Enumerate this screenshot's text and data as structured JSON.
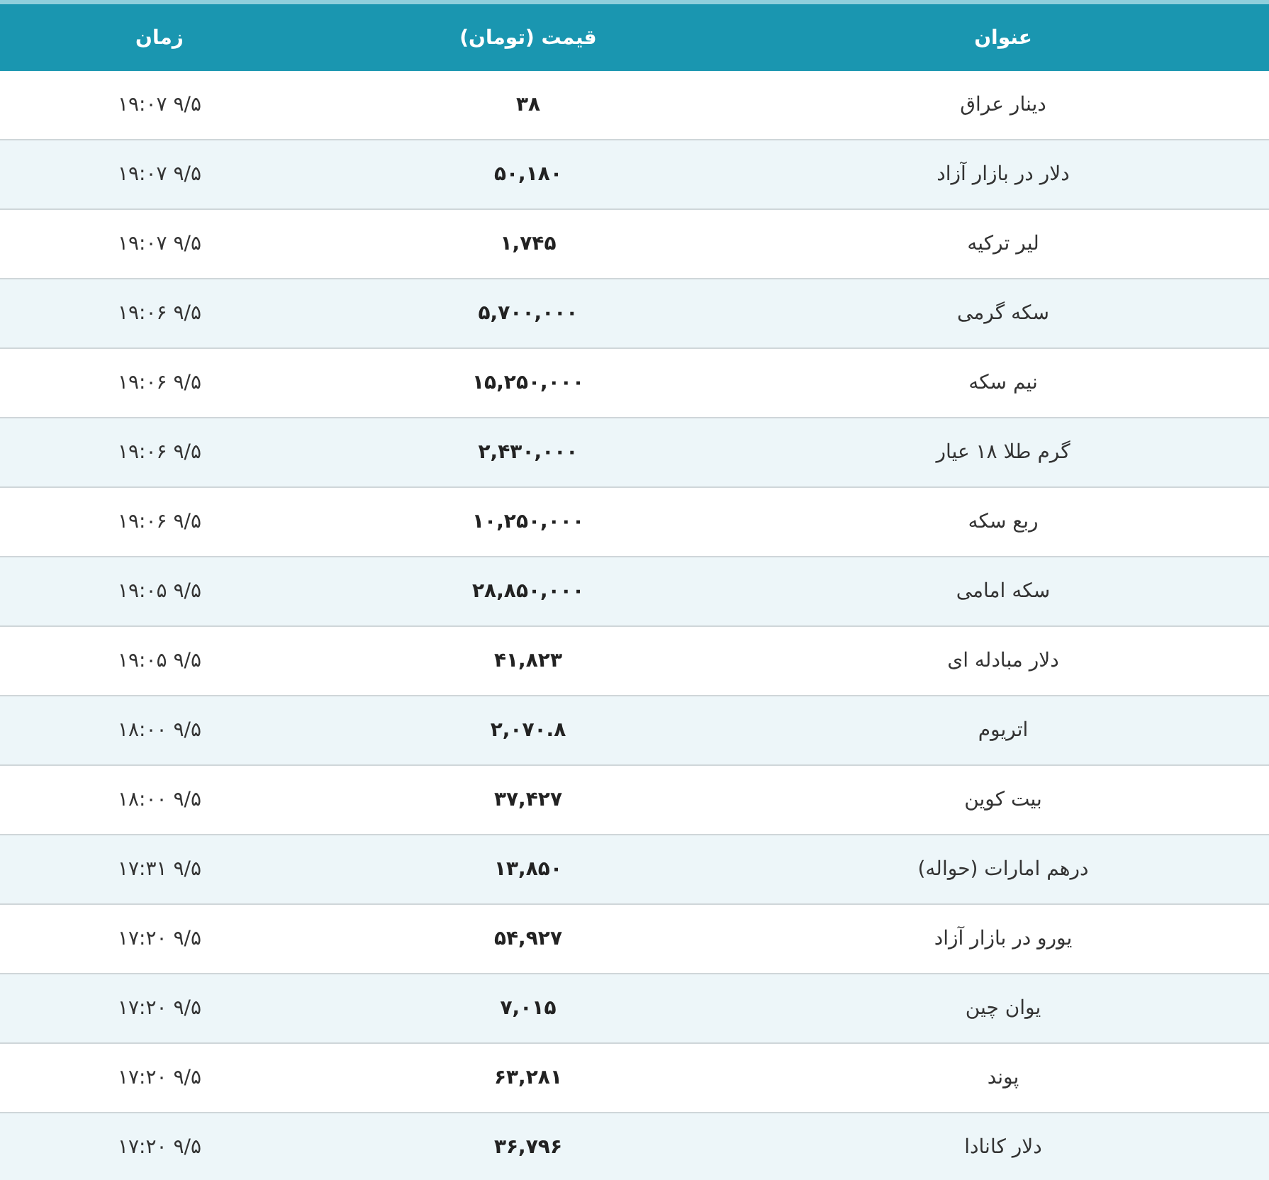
{
  "table": {
    "columns": [
      "عنوان",
      "قیمت (تومان)",
      "زمان"
    ],
    "rows": [
      {
        "title": "دینار عراق",
        "price": "۳۸",
        "time": "۹/۵ ۱۹:۰۷"
      },
      {
        "title": "دلار در بازار آزاد",
        "price": "۵۰,۱۸۰",
        "time": "۹/۵ ۱۹:۰۷"
      },
      {
        "title": "لیر ترکیه",
        "price": "۱,۷۴۵",
        "time": "۹/۵ ۱۹:۰۷"
      },
      {
        "title": "سکه گرمی",
        "price": "۵,۷۰۰,۰۰۰",
        "time": "۹/۵ ۱۹:۰۶"
      },
      {
        "title": "نیم سکه",
        "price": "۱۵,۲۵۰,۰۰۰",
        "time": "۹/۵ ۱۹:۰۶"
      },
      {
        "title": "گرم طلا ۱۸ عیار",
        "price": "۲,۴۳۰,۰۰۰",
        "time": "۹/۵ ۱۹:۰۶"
      },
      {
        "title": "ربع سکه",
        "price": "۱۰,۲۵۰,۰۰۰",
        "time": "۹/۵ ۱۹:۰۶"
      },
      {
        "title": "سکه امامی",
        "price": "۲۸,۸۵۰,۰۰۰",
        "time": "۹/۵ ۱۹:۰۵"
      },
      {
        "title": "دلار مبادله ای",
        "price": "۴۱,۸۲۳",
        "time": "۹/۵ ۱۹:۰۵"
      },
      {
        "title": "اتریوم",
        "price": "۲,۰۷۰.۸",
        "time": "۹/۵ ۱۸:۰۰"
      },
      {
        "title": "بیت کوین",
        "price": "۳۷,۴۲۷",
        "time": "۹/۵ ۱۸:۰۰"
      },
      {
        "title": "درهم امارات (حواله)",
        "price": "۱۳,۸۵۰",
        "time": "۹/۵ ۱۷:۳۱"
      },
      {
        "title": "یورو در بازار آزاد",
        "price": "۵۴,۹۲۷",
        "time": "۹/۵ ۱۷:۲۰"
      },
      {
        "title": "یوان چین",
        "price": "۷,۰۱۵",
        "time": "۹/۵ ۱۷:۲۰"
      },
      {
        "title": "پوند",
        "price": "۶۳,۲۸۱",
        "time": "۹/۵ ۱۷:۲۰"
      },
      {
        "title": "دلار کانادا",
        "price": "۳۶,۷۹۶",
        "time": "۹/۵ ۱۷:۲۰"
      }
    ]
  }
}
